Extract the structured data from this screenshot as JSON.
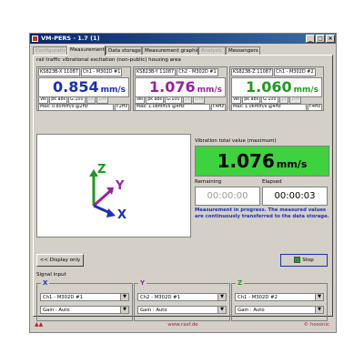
{
  "window": {
    "title": "VM-PERS - 1.7 (1)",
    "min": "_",
    "max": "□",
    "close": "×"
  },
  "tabs": [
    {
      "label": "Configuration",
      "disabled": true
    },
    {
      "label": "Measurement",
      "active": true
    },
    {
      "label": "Data storage"
    },
    {
      "label": "Measurement graphic"
    },
    {
      "label": "Analysis",
      "disabled": true
    },
    {
      "label": "Messengers"
    }
  ],
  "subtitle": "rail traffic vibrational excitation (non-public) housing area",
  "channels": [
    {
      "sensor": "KS823B-X 11087",
      "channel": "Ch1 - M302D #1",
      "value": "0.854",
      "unit": "mm/s",
      "color": "#1c2fb5",
      "row1": [
        "Vel",
        "pk abs",
        "G:100",
        "1X",
        "10X"
      ],
      "max": "Max: 0.85mm/s @2Hz",
      "freq": "f:2Hz"
    },
    {
      "sensor": "KS823B-Y 11087",
      "channel": "Ch2 - M302D #1",
      "value": "1.076",
      "unit": "mm/s",
      "color": "#9b1fa6",
      "row1": [
        "Vel",
        "pk abs",
        "G:100",
        "1X",
        "10X"
      ],
      "max": "Max: 1.08mm/s @4Hz",
      "freq": "f:4Hz"
    },
    {
      "sensor": "KS823B-Z 11087",
      "channel": "Ch1 - M302D #2",
      "value": "1.060",
      "unit": "mm/s",
      "color": "#1f9a1f",
      "row1": [
        "Vel",
        "pk abs",
        "G:100",
        "1X",
        "10X"
      ],
      "max": "Max: 1.06mm/s @4Hz",
      "freq": "f:4Hz"
    }
  ],
  "axes": {
    "x": "X",
    "y": "Y",
    "z": "Z",
    "x_color": "#1c2fb5",
    "y_color": "#9b1fa6",
    "z_color": "#1f9a1f"
  },
  "total": {
    "label": "Vibration total value (maximum)",
    "value": "1.076",
    "unit": "mm/s",
    "color": "#3ed23e"
  },
  "time": {
    "remaining_label": "Remaining",
    "remaining": "00:00:00",
    "elapsed_label": "Elapsed",
    "elapsed": "00:00:03"
  },
  "message": "Measurement in progress. The measured values are continuously transferred to the data storage.",
  "buttons": {
    "display_only": "<< Display only",
    "stop": "Stop"
  },
  "signal_input": {
    "label": "Signal input",
    "groups": [
      {
        "axis": "X",
        "channel": "Ch1 - M302D #1",
        "gain": "Gain : Auto"
      },
      {
        "axis": "Y",
        "channel": "Ch2 - M302D #1",
        "gain": "Gain : Auto"
      },
      {
        "axis": "Z",
        "channel": "Ch1 - M302D #2",
        "gain": "Gain : Auto"
      }
    ]
  },
  "status": {
    "url": "www.rasf.de",
    "brand": "© hosonic"
  }
}
